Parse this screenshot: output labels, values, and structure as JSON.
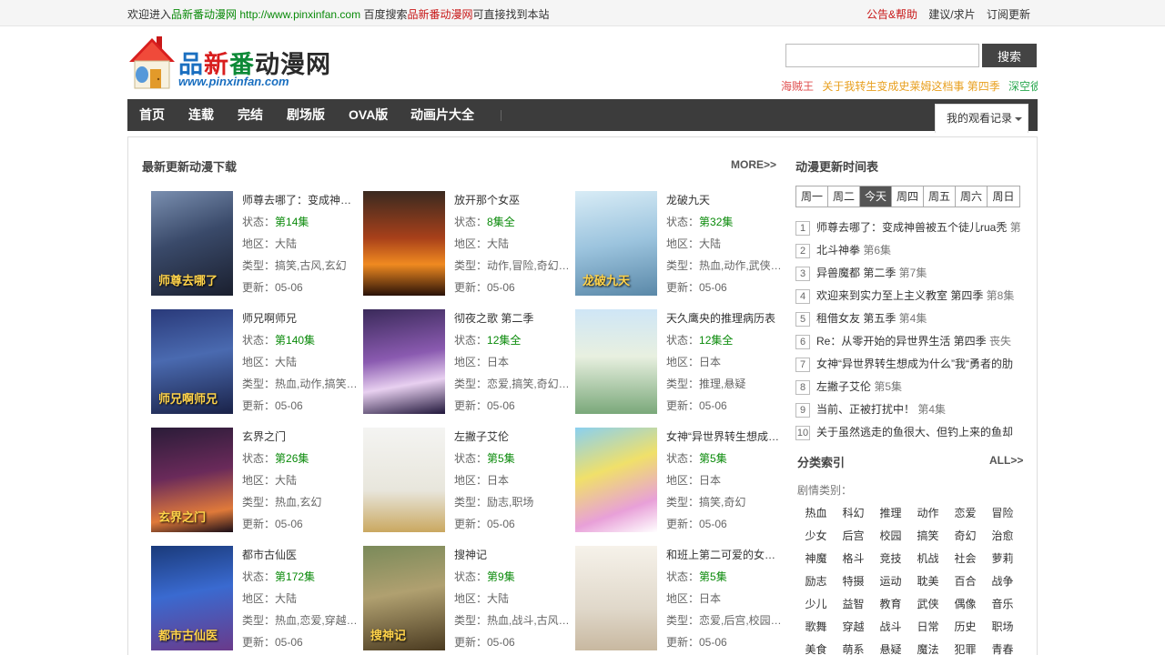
{
  "topbar": {
    "welcome": "欢迎进入",
    "site_name": "品新番动漫网",
    "site_url": "http://www.pinxinfan.com",
    "baidu_text": "百度搜索",
    "site_name2": "品新番动漫网",
    "suffix": "可直接找到本站",
    "links": [
      "公告&帮助",
      "建议/求片",
      "订阅更新"
    ]
  },
  "logo": {
    "title_parts": [
      "品",
      "新",
      "番",
      "动漫网"
    ],
    "url": "www.pinxinfan.com"
  },
  "search": {
    "value": "",
    "placeholder": "",
    "button": "搜索"
  },
  "hot": [
    {
      "text": "海贼王",
      "color": "#e05050"
    },
    {
      "text": "关于我转生变成史莱姆这档事 第四季",
      "color": "#e8a020"
    },
    {
      "text": "深空彼岸",
      "color": "#2aa850"
    }
  ],
  "nav": {
    "items": [
      "首页",
      "连载",
      "完结",
      "剧场版",
      "OVA版",
      "动画片大全"
    ],
    "watch_history": "我的观看记录"
  },
  "latest": {
    "title": "最新更新动漫下载",
    "more": "MORE>>",
    "labels": {
      "status": "状态：",
      "region": "地区：",
      "genre": "类型：",
      "update": "更新："
    },
    "items": [
      {
        "title": "师尊去哪了：变成神兽被五个徒儿rua秃",
        "cap": "师尊去哪了",
        "status": "第14集",
        "region": "大陆",
        "genre": "搞笑,古风,玄幻",
        "update": "05-06"
      },
      {
        "title": "放开那个女巫",
        "cap": "",
        "status": "8集全",
        "region": "大陆",
        "genre": "动作,冒险,奇幻,战争",
        "update": "05-06"
      },
      {
        "title": "龙破九天",
        "cap": "龙破九天",
        "status": "第32集",
        "region": "大陆",
        "genre": "热血,动作,武侠,玄幻",
        "update": "05-06"
      },
      {
        "title": "师兄啊师兄",
        "cap": "师兄啊师兄",
        "status": "第140集",
        "region": "大陆",
        "genre": "热血,动作,搞笑,玄幻",
        "update": "05-06"
      },
      {
        "title": "彻夜之歌 第二季",
        "cap": "",
        "status": "12集全",
        "region": "日本",
        "genre": "恋爱,搞笑,奇幻,校园",
        "update": "05-06"
      },
      {
        "title": "天久鹰央的推理病历表",
        "cap": "",
        "status": "12集全",
        "region": "日本",
        "genre": "推理,悬疑",
        "update": "05-06"
      },
      {
        "title": "玄界之门",
        "cap": "玄界之门",
        "status": "第26集",
        "region": "大陆",
        "genre": "热血,玄幻",
        "update": "05-06"
      },
      {
        "title": "左撇子艾伦",
        "cap": "",
        "status": "第5集",
        "region": "日本",
        "genre": "励志,职场",
        "update": "05-06"
      },
      {
        "title": "女神“异世界转生想成为什么”我“勇者的肋骨”",
        "cap": "",
        "status": "第5集",
        "region": "日本",
        "genre": "搞笑,奇幻",
        "update": "05-06"
      },
      {
        "title": "都市古仙医",
        "cap": "都市古仙医",
        "status": "第172集",
        "region": "大陆",
        "genre": "热血,恋爱,穿越,都市",
        "update": "05-06"
      },
      {
        "title": "搜神记",
        "cap": "搜神记",
        "status": "第9集",
        "region": "大陆",
        "genre": "热血,战斗,古风,玄幻",
        "update": "05-06"
      },
      {
        "title": "和班上第二可爱的女孩成为朋友",
        "cap": "",
        "status": "第5集",
        "region": "日本",
        "genre": "恋爱,后宫,校园,日常",
        "update": "05-06"
      }
    ]
  },
  "schedule": {
    "title": "动漫更新时间表",
    "days": [
      "周一",
      "周二",
      "今天",
      "周四",
      "周五",
      "周六",
      "周日"
    ],
    "active_index": 2,
    "items": [
      {
        "title": "师尊去哪了：变成神兽被五个徒儿rua秃",
        "ep": "第"
      },
      {
        "title": "北斗神拳",
        "ep": "第6集"
      },
      {
        "title": "异兽魔都 第二季",
        "ep": "第7集"
      },
      {
        "title": "欢迎来到实力至上主义教室 第四季",
        "ep": "第8集"
      },
      {
        "title": "租借女友 第五季",
        "ep": "第4集"
      },
      {
        "title": "Re：从零开始的异世界生活 第四季",
        "ep": "丧失"
      },
      {
        "title": "女神“异世界转生想成为什么”我“勇者的肋",
        "ep": ""
      },
      {
        "title": "左撇子艾伦",
        "ep": "第5集"
      },
      {
        "title": "当前、正被打扰中！",
        "ep": "第4集"
      },
      {
        "title": "关于虽然逃走的鱼很大、但钓上来的鱼却",
        "ep": ""
      }
    ]
  },
  "categories": {
    "title": "分类索引",
    "all": "ALL>>",
    "label": "剧情类别：",
    "items": [
      "热血",
      "科幻",
      "推理",
      "动作",
      "恋爱",
      "冒险",
      "少女",
      "后宫",
      "校园",
      "搞笑",
      "奇幻",
      "治愈",
      "神魔",
      "格斗",
      "竞技",
      "机战",
      "社会",
      "萝莉",
      "励志",
      "特摄",
      "运动",
      "耽美",
      "百合",
      "战争",
      "少儿",
      "益智",
      "教育",
      "武侠",
      "偶像",
      "音乐",
      "歌舞",
      "穿越",
      "战斗",
      "日常",
      "历史",
      "职场",
      "美食",
      "萌系",
      "悬疑",
      "魔法",
      "犯罪",
      "青春"
    ]
  },
  "colors": {
    "nav_bg": "#3c3c3c",
    "status_green": "#0a8a0a",
    "accent_red": "#c81818",
    "logo_blue": "#1a6fc0"
  }
}
